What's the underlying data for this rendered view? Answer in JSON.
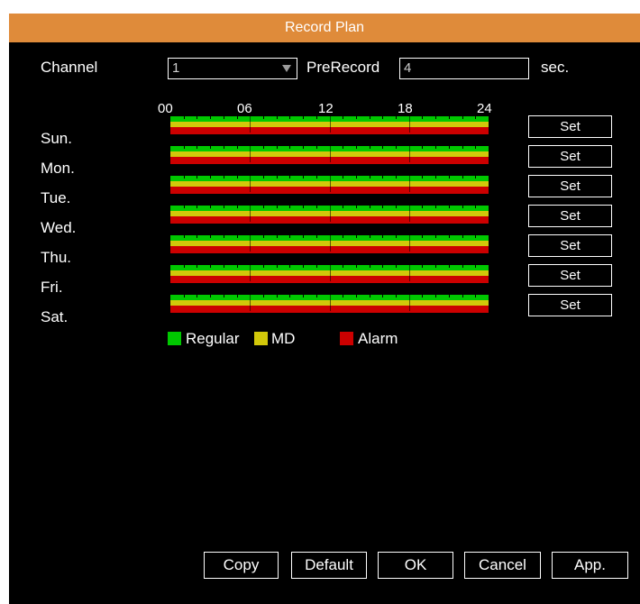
{
  "title": "Record Plan",
  "channel": {
    "label": "Channel",
    "value": "1"
  },
  "prerecord": {
    "label": "PreRecord",
    "value": "4",
    "unit": "sec."
  },
  "hour_labels": [
    "00",
    "06",
    "12",
    "18",
    "24"
  ],
  "days": [
    {
      "label": "Sun.",
      "set_label": "Set"
    },
    {
      "label": "Mon.",
      "set_label": "Set"
    },
    {
      "label": "Tue.",
      "set_label": "Set"
    },
    {
      "label": "Wed.",
      "set_label": "Set"
    },
    {
      "label": "Thu.",
      "set_label": "Set"
    },
    {
      "label": "Fri.",
      "set_label": "Set"
    },
    {
      "label": "Sat.",
      "set_label": "Set"
    }
  ],
  "legend": [
    {
      "label": "Regular",
      "color": "#00c800"
    },
    {
      "label": "MD",
      "color": "#d2c80a"
    },
    {
      "label": "Alarm",
      "color": "#cc0000"
    }
  ],
  "buttons": {
    "copy": "Copy",
    "default": "Default",
    "ok": "OK",
    "cancel": "Cancel",
    "apply": "App."
  },
  "colors": {
    "title_bar": "#df8b3a",
    "background": "#000000"
  }
}
